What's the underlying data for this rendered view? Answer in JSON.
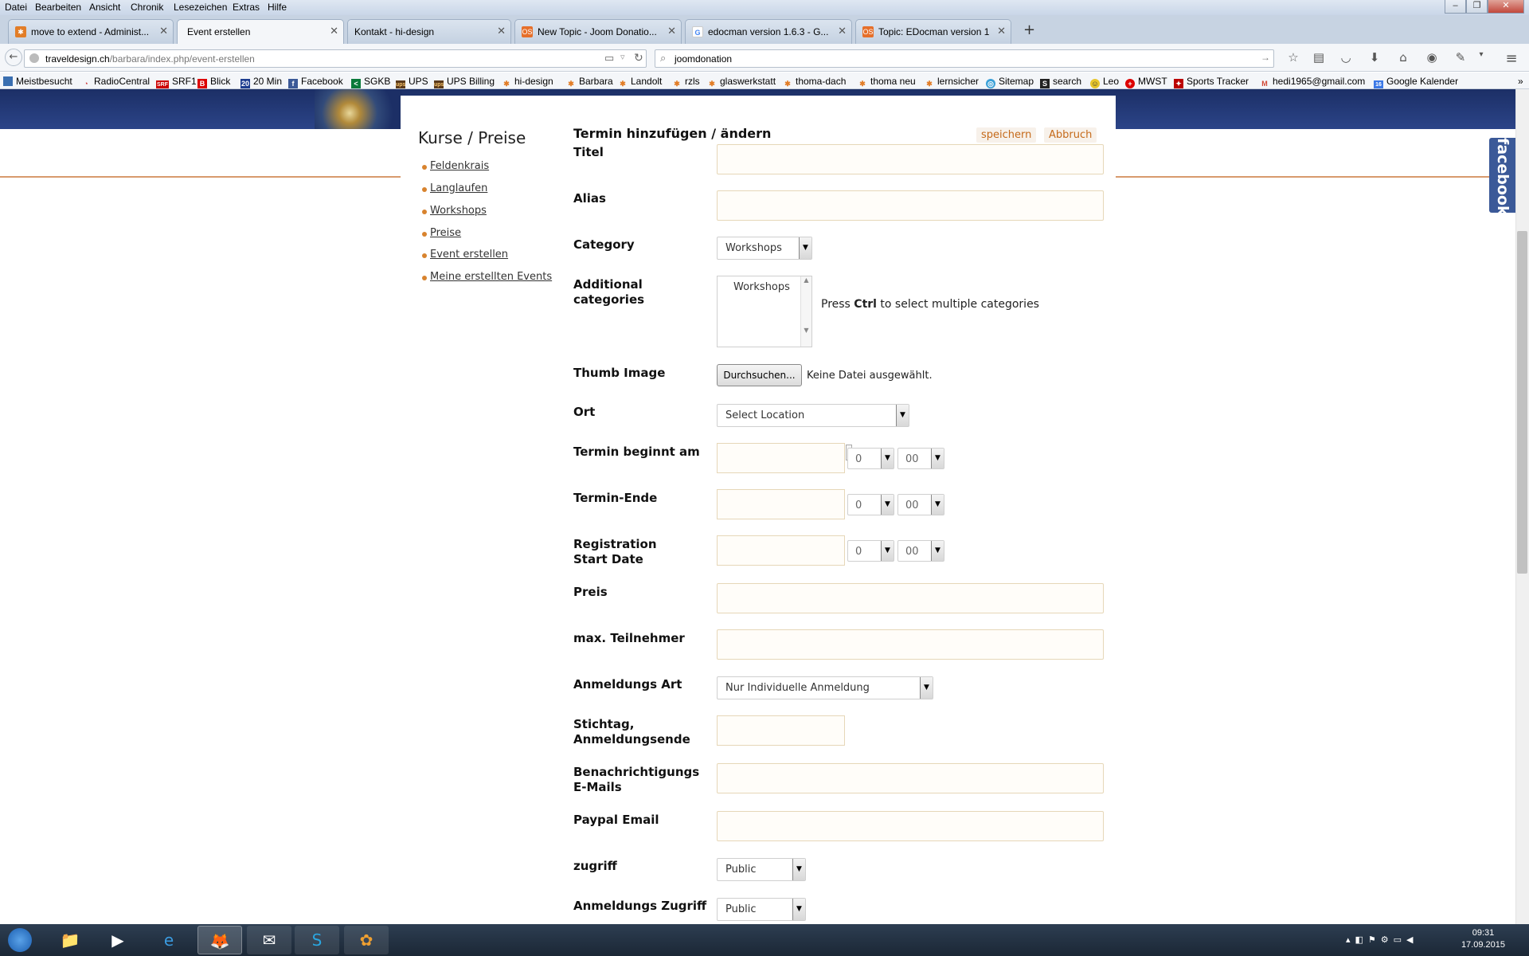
{
  "menubar": {
    "items": [
      "Datei",
      "Bearbeiten",
      "Ansicht",
      "Chronik",
      "Lesezeichen",
      "Extras",
      "Hilfe"
    ]
  },
  "tabs": [
    {
      "label": "move to extend - Administ...",
      "icon": "joomla-icon"
    },
    {
      "label": "Event erstellen",
      "icon": ""
    },
    {
      "label": "Kontakt - hi-design",
      "icon": ""
    },
    {
      "label": "New Topic - Joom Donatio...",
      "icon": "os-icon"
    },
    {
      "label": "edocman version 1.6.3 - G...",
      "icon": "google-icon"
    },
    {
      "label": "Topic: EDocman version 1....",
      "icon": "os-icon"
    }
  ],
  "nav": {
    "url_host": "traveldesign.ch",
    "url_path": "/barbara/index.php/event-erstellen",
    "search": "joomdonation"
  },
  "bookmarks": [
    "Meistbesucht",
    "RadioCentral",
    "SRF1",
    "Blick",
    "20 Min",
    "Facebook",
    "SGKB",
    "UPS",
    "UPS Billing",
    "hi-design",
    "Barbara",
    "Landolt",
    "rzls",
    "glaswerkstatt",
    "thoma-dach",
    "thoma neu",
    "lernsicher",
    "Sitemap",
    "search",
    "Leo",
    "MWST",
    "Sports Tracker",
    "hedi1965@gmail.com",
    "Google Kalender"
  ],
  "sidebar": {
    "title": "Kurse / Preise",
    "items": [
      "Feldenkrais",
      "Langlaufen",
      "Workshops",
      "Preise",
      "Event erstellen",
      "Meine erstellten Events"
    ]
  },
  "form": {
    "title": "Termin hinzufügen / ändern",
    "save": "speichern",
    "cancel": "Abbruch",
    "labels": {
      "titel": "Titel",
      "alias": "Alias",
      "category": "Category",
      "additional": "Additional categories",
      "thumb": "Thumb Image",
      "ort": "Ort",
      "start": "Termin beginnt am",
      "end": "Termin-Ende",
      "regstart": "Registration Start Date",
      "preis": "Preis",
      "max": "max. Teilnehmer",
      "art": "Anmeldungs Art",
      "stichtag": "Stichtag, Anmeldungsende",
      "notify": "Benachrichtigungs E-Mails",
      "paypal": "Paypal Email",
      "zugriff": "zugriff",
      "anmzugriff": "Anmeldungs Zugriff"
    },
    "category_value": "Workshops",
    "additional_option": "Workshops",
    "ctrl_hint_pre": "Press ",
    "ctrl_hint_key": "Ctrl",
    "ctrl_hint_post": " to select multiple categories",
    "browse": "Durchsuchen...",
    "no_file": "Keine Datei ausgewählt.",
    "location": "Select Location",
    "hour": "0",
    "minute": "00",
    "art_value": "Nur Individuelle Anmeldung",
    "access_value": "Public",
    "reg_access_value": "Public"
  },
  "facebook": "facebook",
  "clock": {
    "time": "09:31",
    "date": "17.09.2015"
  }
}
